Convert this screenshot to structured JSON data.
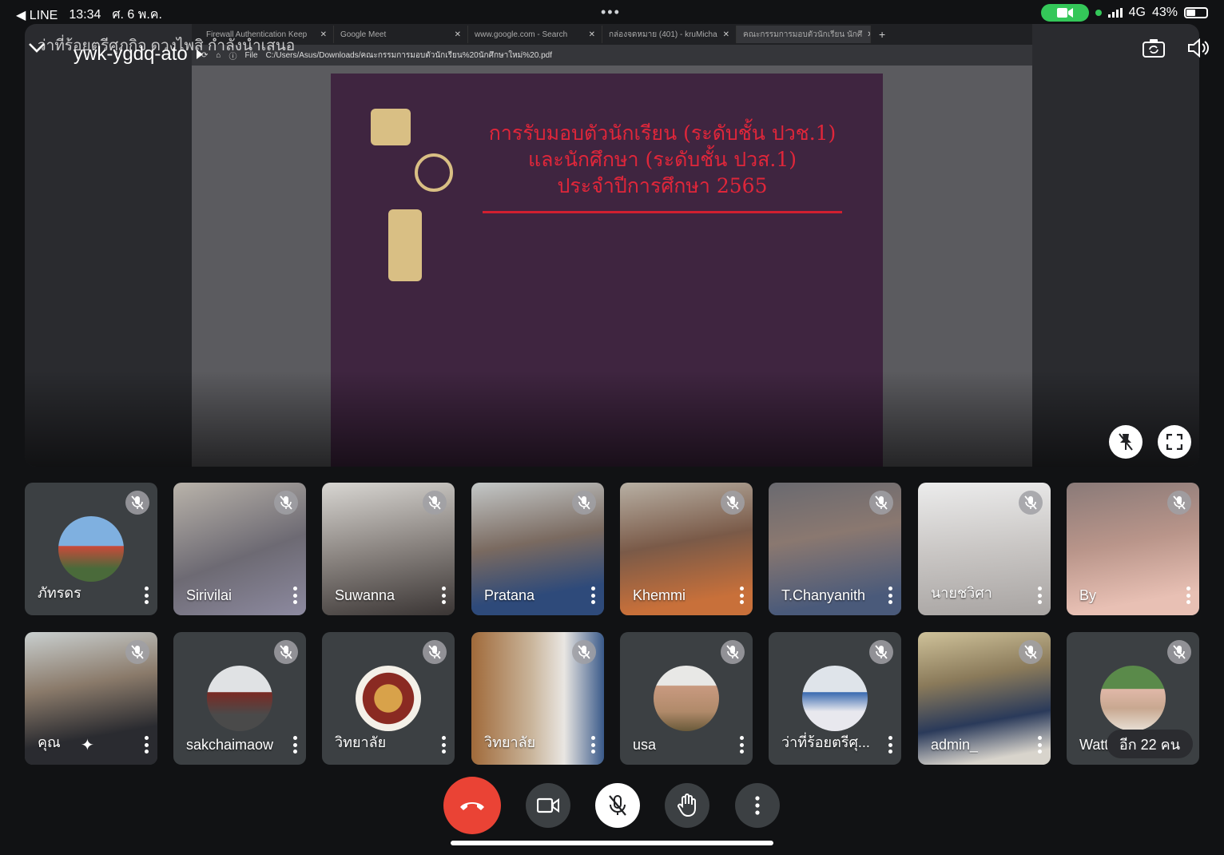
{
  "status_bar": {
    "back_app": "◀ LINE",
    "time": "13:34",
    "date": "ศ. 6 พ.ค.",
    "network": "4G",
    "battery": "43%"
  },
  "meeting": {
    "presenter_banner": "ว่าที่ร้อยตรีศุภกิจ ดวงไพสิ กำลังนำเสนอ",
    "code": "ywk-ygdq-ato"
  },
  "browser": {
    "tabs": [
      "Firewall Authentication Keep",
      "Google Meet",
      "www.google.com - Search",
      "กล่องจดหมาย (401) - kruMicha",
      "คณะกรรมการมอบตัวนักเรียน นักศึ"
    ],
    "url_scheme": "File",
    "url": "C:/Users/Asus/Downloads/คณะกรรมการมอบตัวนักเรียน%20นักศึกษาใหม่%20.pdf"
  },
  "slide": {
    "title_lines": [
      "การรับมอบตัวนักเรียน (ระดับชั้น ปวช.1)",
      "และนักศึกษา (ระดับชั้น ปวส.1)",
      "ประจำปีการศึกษา 2565"
    ]
  },
  "participants": [
    {
      "name": "ภัทรดร"
    },
    {
      "name": "Sirivilai"
    },
    {
      "name": "Suwanna"
    },
    {
      "name": "Pratana"
    },
    {
      "name": "Khemmi"
    },
    {
      "name": "T.Chanyanith"
    },
    {
      "name": "นายชวิศา"
    },
    {
      "name": "By"
    },
    {
      "name": "คุณ"
    },
    {
      "name": "sakchaimaow"
    },
    {
      "name": "วิทยาลัย"
    },
    {
      "name": "วิทยาลัย"
    },
    {
      "name": "usa"
    },
    {
      "name": "ว่าที่ร้อยตรีศุ..."
    },
    {
      "name": "admin_"
    },
    {
      "name": "Watt"
    }
  ],
  "others_count": "อีก 22 คน",
  "colors": {
    "hangup": "#ea4335",
    "tile_bg": "#3c4043",
    "slide_bg": "#3f2540",
    "slide_title": "#e0263a"
  }
}
